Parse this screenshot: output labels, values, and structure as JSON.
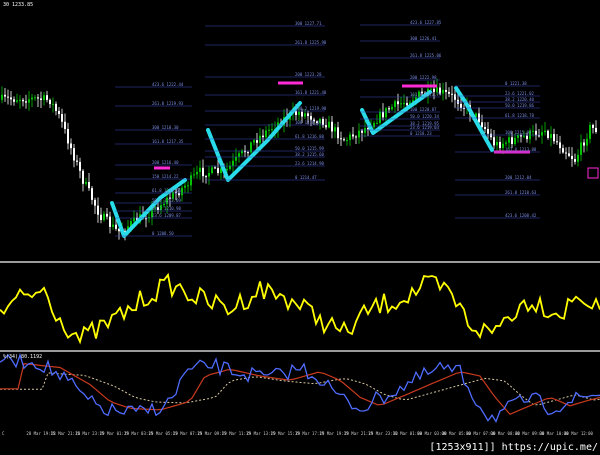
{
  "symbol_header": "30 1233.85",
  "stoch_label": "%(34) 80.1192",
  "watermark": "[1253x911]] https://upic.me/",
  "colors": {
    "background": "#000000",
    "bull_candle": "#00c400",
    "bear_candle": "#ffffff",
    "zigzag": "#28dcea",
    "marker": "#ff2bd6",
    "fib_line": "#3c4bbd",
    "fib_text": "#7b8ce0",
    "oscillator": "#ffff00",
    "stoch_main": "#4f6cff",
    "stoch_signal": "#c83a1e",
    "stoch_slow": "#d8c9a0",
    "separator": "#9a9a9a"
  },
  "fib_levels": [
    {
      "group": "g1",
      "labels": [
        "423.6 1222.44",
        "261.8 1219.93",
        "300 1218.30",
        "161.8 1217.35",
        "200 1216.40",
        "150 1214.22",
        "61.8 1213.66",
        "50.0 1212.09",
        "38.2 1210.98",
        "23.6 1209.87",
        "0 1208.50"
      ]
    },
    {
      "group": "g2",
      "labels": [
        "300 1227.71",
        "261.8 1225.98",
        "200 1223.28",
        "161.8 1221.40",
        "138.2 1219.98",
        "100 1218.45",
        "61.8 1216.80",
        "50.0 1215.99",
        "38.2 1215.60",
        "23.6 1214.90",
        "0 1214.47"
      ]
    },
    {
      "group": "g3",
      "labels": [
        "423.6 1227.85",
        "300 1226.41",
        "261.8 1225.06",
        "200 1222.98",
        "161.8 1221.79",
        "100 1220.87",
        "50.0 1220.34",
        "38.2 1219.95",
        "23.6 1219.03",
        "0 1218.23"
      ]
    },
    {
      "group": "g4",
      "labels": [
        "0 1221.38",
        "23.6 1221.02",
        "38.2 1220.40",
        "50.0 1219.86",
        "61.8 1218.78",
        "100 1215.97",
        "161.8 1213.88",
        "200 1212.04",
        "261.8 1210.63",
        "423.6 1208.42"
      ]
    }
  ],
  "time_axis": [
    "C",
    "28 Mar 19:15",
    "28 Mar 21:15",
    "28 Mar 23:15",
    "29 Mar 01:15",
    "29 Mar 03:15",
    "29 Mar 05:15",
    "29 Mar 07:15",
    "29 Mar 09:15",
    "29 Mar 11:15",
    "29 Mar 13:15",
    "29 Mar 15:15",
    "29 Mar 17:15",
    "29 Mar 19:15",
    "29 Mar 21:15",
    "29 Mar 23:15",
    "30 Mar 01:00",
    "30 Mar 03:00",
    "30 Mar 05:00",
    "30 Mar 07:00",
    "30 Mar 08:00",
    "30 Mar 09:00",
    "30 Mar 10:00",
    "30 Mar 12:00"
  ]
}
